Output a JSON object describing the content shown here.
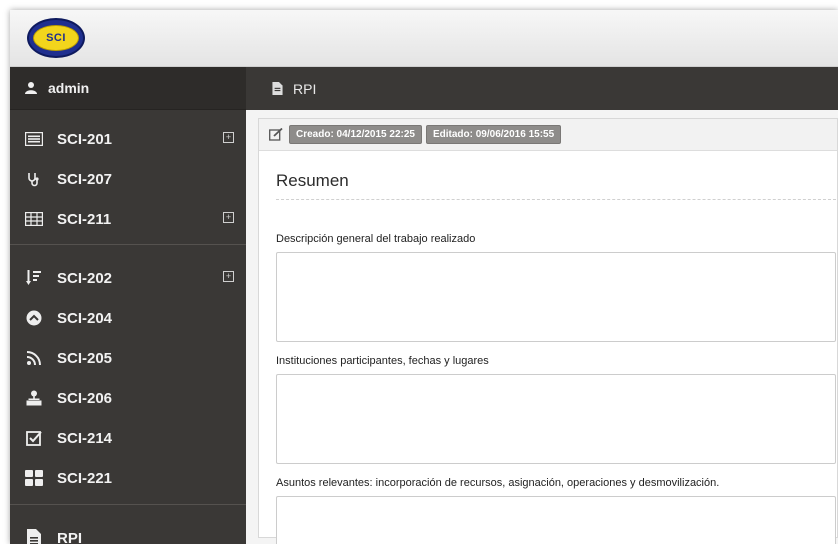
{
  "app": {
    "logo_text": "SCI"
  },
  "sidebar": {
    "user": "admin",
    "items": [
      {
        "label": "SCI-201",
        "icon": "list-icon",
        "expandable": true
      },
      {
        "label": "SCI-207",
        "icon": "stethoscope-icon",
        "expandable": false
      },
      {
        "label": "SCI-211",
        "icon": "table-icon",
        "expandable": true
      },
      {
        "label": "SCI-202",
        "icon": "sort-icon",
        "expandable": true
      },
      {
        "label": "SCI-204",
        "icon": "chevron-circle-up-icon",
        "expandable": false
      },
      {
        "label": "SCI-205",
        "icon": "rss-icon",
        "expandable": false
      },
      {
        "label": "SCI-206",
        "icon": "sitemap-icon",
        "expandable": false
      },
      {
        "label": "SCI-214",
        "icon": "checkbox-icon",
        "expandable": false
      },
      {
        "label": "SCI-221",
        "icon": "th-large-icon",
        "expandable": false
      },
      {
        "label": "RPI",
        "icon": "file-icon",
        "expandable": false
      }
    ],
    "expand_glyph": "+"
  },
  "main": {
    "title": "RPI",
    "created": "Creado: 04/12/2015 22:25",
    "edited": "Editado: 09/06/2016 15:55",
    "section_title": "Resumen",
    "fields": [
      {
        "label": "Descripción general del trabajo realizado",
        "value": ""
      },
      {
        "label": "Instituciones participantes, fechas y lugares",
        "value": ""
      },
      {
        "label": "Asuntos relevantes: incorporación de recursos, asignación, operaciones y desmovilización.",
        "value": ""
      }
    ]
  }
}
